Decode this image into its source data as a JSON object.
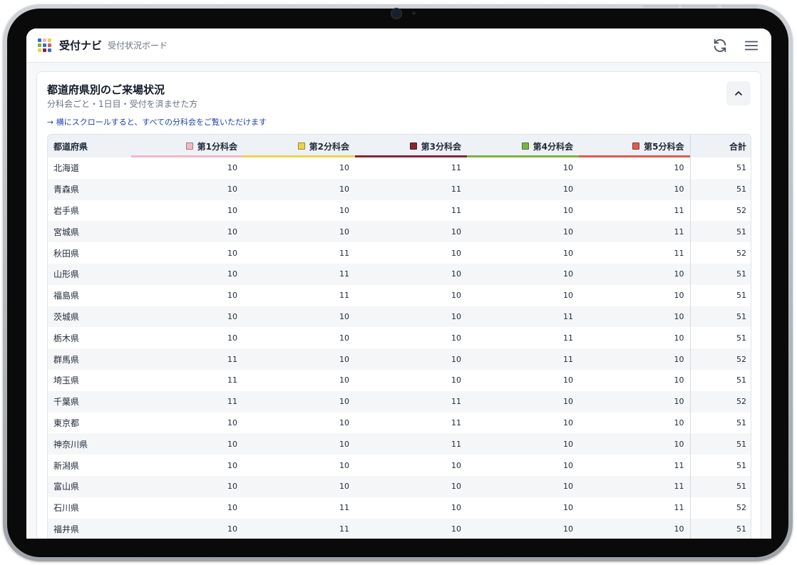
{
  "app": {
    "name": "受付ナビ",
    "subtitle": "受付状況ボード"
  },
  "card": {
    "title": "都道府県別のご来場状況",
    "subtitle": "分科会ごと・1日目・受付を済ませた方",
    "hint": "→ 横にスクロールすると、すべての分科会をご覧いただけます"
  },
  "table": {
    "headers": {
      "prefecture": "都道府県",
      "divisions": [
        {
          "label": "第1分科会",
          "color": "#f2b8c6"
        },
        {
          "label": "第2分科会",
          "color": "#e8d44d"
        },
        {
          "label": "第3分科会",
          "color": "#8b2331"
        },
        {
          "label": "第4分科会",
          "color": "#7cb342"
        },
        {
          "label": "第5分科会",
          "color": "#e05a4e"
        }
      ],
      "total": "合計"
    },
    "rows": [
      {
        "pref": "北海道",
        "d1": "10",
        "d2": "10",
        "d3": "11",
        "d4": "10",
        "d5": "10",
        "total": "51"
      },
      {
        "pref": "青森県",
        "d1": "10",
        "d2": "10",
        "d3": "11",
        "d4": "10",
        "d5": "10",
        "total": "51"
      },
      {
        "pref": "岩手県",
        "d1": "10",
        "d2": "10",
        "d3": "11",
        "d4": "10",
        "d5": "11",
        "total": "52"
      },
      {
        "pref": "宮城県",
        "d1": "10",
        "d2": "10",
        "d3": "10",
        "d4": "10",
        "d5": "11",
        "total": "51"
      },
      {
        "pref": "秋田県",
        "d1": "10",
        "d2": "11",
        "d3": "10",
        "d4": "10",
        "d5": "11",
        "total": "52"
      },
      {
        "pref": "山形県",
        "d1": "10",
        "d2": "11",
        "d3": "10",
        "d4": "10",
        "d5": "10",
        "total": "51"
      },
      {
        "pref": "福島県",
        "d1": "10",
        "d2": "11",
        "d3": "10",
        "d4": "10",
        "d5": "10",
        "total": "51"
      },
      {
        "pref": "茨城県",
        "d1": "10",
        "d2": "10",
        "d3": "10",
        "d4": "11",
        "d5": "10",
        "total": "51"
      },
      {
        "pref": "栃木県",
        "d1": "10",
        "d2": "10",
        "d3": "10",
        "d4": "11",
        "d5": "10",
        "total": "51"
      },
      {
        "pref": "群馬県",
        "d1": "11",
        "d2": "10",
        "d3": "10",
        "d4": "11",
        "d5": "10",
        "total": "52"
      },
      {
        "pref": "埼玉県",
        "d1": "11",
        "d2": "10",
        "d3": "10",
        "d4": "10",
        "d5": "10",
        "total": "51"
      },
      {
        "pref": "千葉県",
        "d1": "11",
        "d2": "10",
        "d3": "11",
        "d4": "10",
        "d5": "10",
        "total": "52"
      },
      {
        "pref": "東京都",
        "d1": "10",
        "d2": "10",
        "d3": "11",
        "d4": "10",
        "d5": "10",
        "total": "51"
      },
      {
        "pref": "神奈川県",
        "d1": "10",
        "d2": "10",
        "d3": "11",
        "d4": "10",
        "d5": "10",
        "total": "51"
      },
      {
        "pref": "新潟県",
        "d1": "10",
        "d2": "10",
        "d3": "10",
        "d4": "10",
        "d5": "11",
        "total": "51"
      },
      {
        "pref": "富山県",
        "d1": "10",
        "d2": "10",
        "d3": "10",
        "d4": "10",
        "d5": "11",
        "total": "51"
      },
      {
        "pref": "石川県",
        "d1": "10",
        "d2": "11",
        "d3": "10",
        "d4": "10",
        "d5": "11",
        "total": "52"
      },
      {
        "pref": "福井県",
        "d1": "10",
        "d2": "11",
        "d3": "10",
        "d4": "10",
        "d5": "10",
        "total": "51"
      }
    ]
  },
  "icons": {
    "logo": "app-logo-icon",
    "refresh": "refresh-icon",
    "menu": "hamburger-menu-icon",
    "collapse": "chevron-up-icon"
  }
}
